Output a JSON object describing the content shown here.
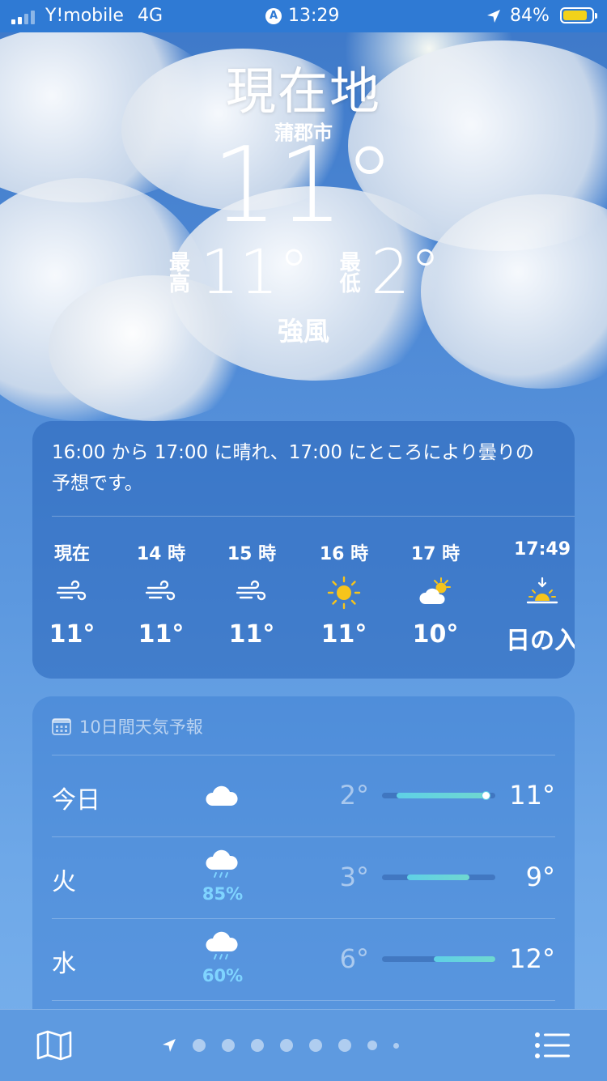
{
  "status_bar": {
    "carrier": "Y!mobile",
    "network": "4G",
    "time": "13:29",
    "battery_percent": "84%",
    "battery_level": 0.84,
    "icons": [
      "signal-icon",
      "navigation-badge-icon",
      "location-arrow-icon",
      "battery-icon"
    ]
  },
  "header": {
    "location_title": "現在地",
    "city": "蒲郡市",
    "temperature": "11°",
    "high_label": "最高",
    "high": "11°",
    "low_label": "最低",
    "low": "2°",
    "condition": "強風"
  },
  "hourly": {
    "summary": "16:00 から 17:00 に晴れ、17:00 にところにより曇りの予想です。",
    "hours": [
      {
        "time": "現在",
        "icon": "wind-icon",
        "temp": "11°"
      },
      {
        "time": "14 時",
        "icon": "wind-icon",
        "temp": "11°"
      },
      {
        "time": "15 時",
        "icon": "wind-icon",
        "temp": "11°"
      },
      {
        "time": "16 時",
        "icon": "sun-icon",
        "temp": "11°"
      },
      {
        "time": "17 時",
        "icon": "partly-cloudy-icon",
        "temp": "10°"
      },
      {
        "time": "17:49",
        "icon": "sunset-icon",
        "temp": "日の入"
      }
    ]
  },
  "daily": {
    "header": "10日間天気予報",
    "header_icon": "calendar-icon",
    "rows": [
      {
        "day": "今日",
        "icon": "cloud-icon",
        "precip": "",
        "low": "2°",
        "high": "11°",
        "range_start": 0.13,
        "range_end": 0.92,
        "current": 0.92
      },
      {
        "day": "火",
        "icon": "rain-cloud-icon",
        "precip": "85%",
        "low": "3°",
        "high": "9°",
        "range_start": 0.22,
        "range_end": 0.77,
        "current": null
      },
      {
        "day": "水",
        "icon": "rain-cloud-icon",
        "precip": "60%",
        "low": "6°",
        "high": "12°",
        "range_start": 0.46,
        "range_end": 1.0,
        "current": null
      }
    ]
  },
  "bottom_bar": {
    "icons": [
      "map-icon",
      "location-arrow-icon",
      "list-icon"
    ],
    "page_count": 8
  },
  "colors": {
    "status_bar": "#2f7ad4",
    "sun": "#f6c41c",
    "precip": "#7fd4ff",
    "temp_bar": "#5fd0e6",
    "battery": "#f2d21a"
  }
}
